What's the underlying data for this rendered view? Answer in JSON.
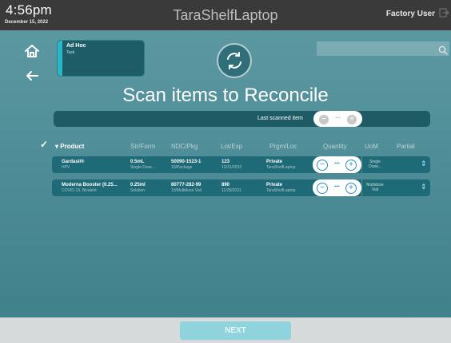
{
  "status_bar": {
    "time": "4:56pm",
    "date": "December 15, 2022",
    "device_name": "TaraShelfLaptop",
    "user": "Factory User"
  },
  "task_card": {
    "title": "Ad Hoc",
    "subtitle": "Task"
  },
  "page": {
    "title": "Scan items to Reconcile"
  },
  "last_scanned": {
    "label": "Last scanned item",
    "quantity": "--"
  },
  "table": {
    "headers": {
      "product": "Product",
      "strength_form": "Str/Form",
      "ndc_pkg": "NDC/Pkg",
      "lot_exp": "Lot/Exp",
      "program_loc": "Prgm/Loc",
      "quantity": "Quantity",
      "uom": "UoM",
      "partial": "Partial"
    },
    "rows": [
      {
        "product": "Gardasil®",
        "product_sub": "HPV",
        "strength": "0.5mL",
        "form": "Single Dose...",
        "ndc": "50090-1523-1",
        "package": "10/Package",
        "lot": "123",
        "exp": "12/31/2033",
        "program": "Private",
        "location": "TaraShelfLaptop",
        "quantity": "--",
        "uom_line1": "Single",
        "uom_line2": "Dose..."
      },
      {
        "product": "Moderna Booster (0.25...",
        "product_sub": "COVID-19, Bivalent",
        "strength": "0.25ml",
        "form": "Solution",
        "ndc": "80777-282-99",
        "package": "10/Multidose Vial",
        "lot": "890",
        "exp": "11/28/2031",
        "program": "Private",
        "location": "TaraShelfLaptop",
        "quantity": "--",
        "uom_line1": "Multidose",
        "uom_line2": "Vial"
      }
    ]
  },
  "footer": {
    "next_label": "NEXT"
  },
  "colors": {
    "accent": "#28b7c8",
    "row_bg": "#1f6a77",
    "pill_blue": "#2b8bbb"
  }
}
